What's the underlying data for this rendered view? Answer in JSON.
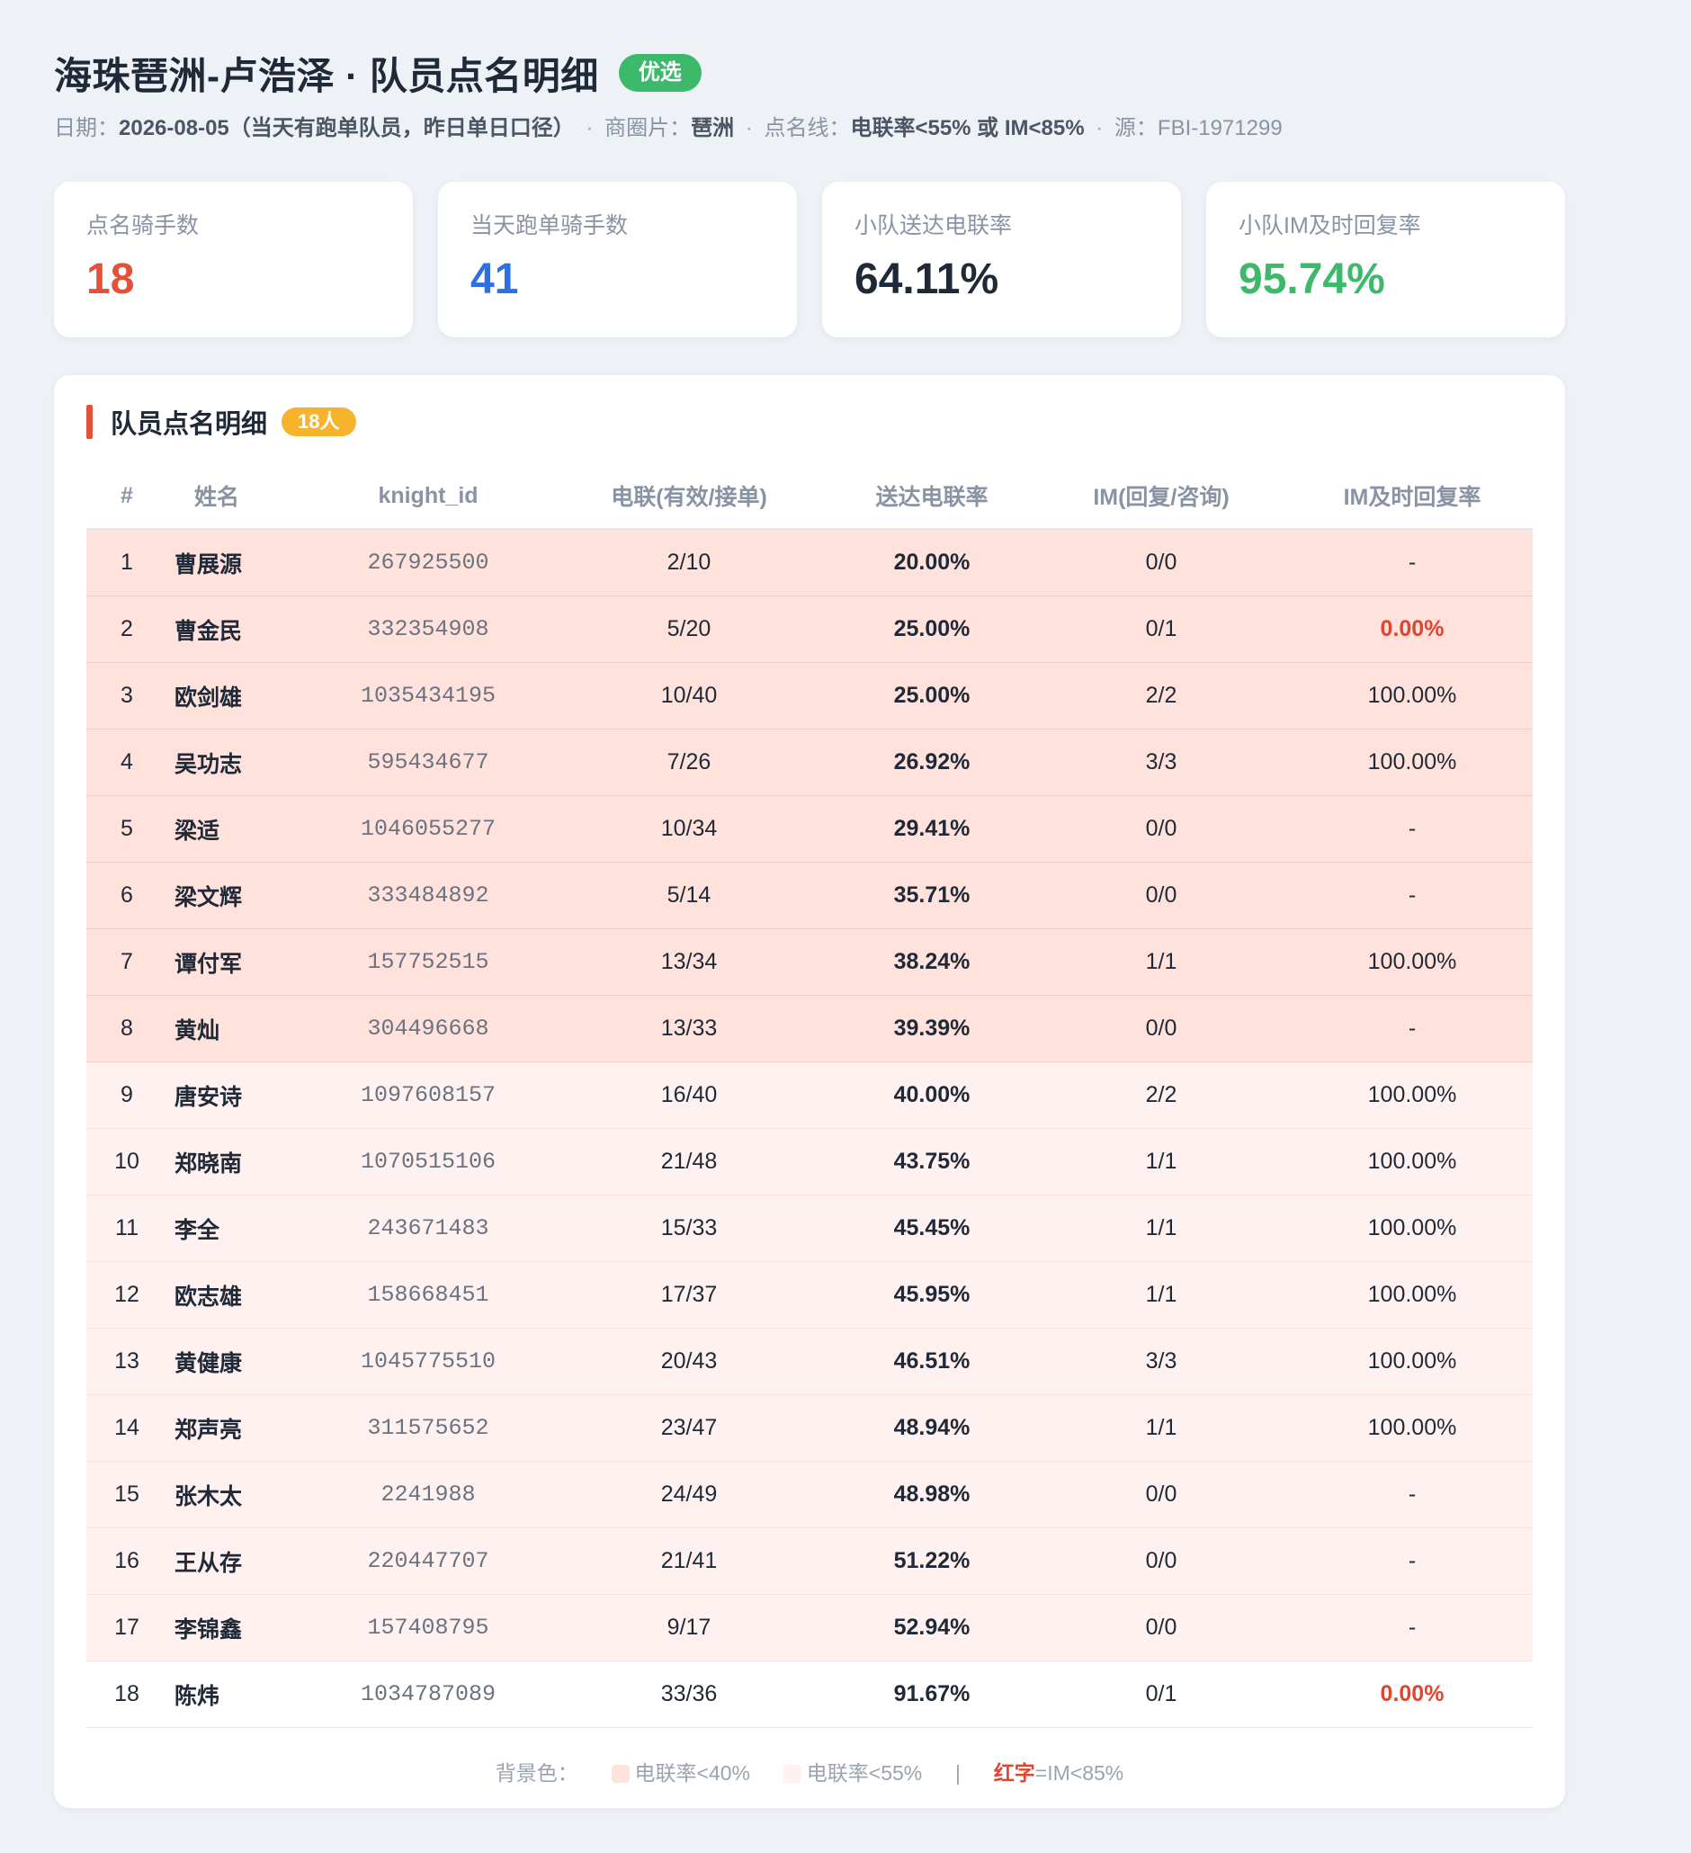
{
  "header": {
    "title": "海珠琶洲-卢浩泽 · 队员点名明细",
    "badge": "优选",
    "date_label": "日期：",
    "date_value": "2026-08-05（当天有跑单队员，昨日单日口径）",
    "sep1": "·",
    "area_label": "商圈片：",
    "area_value": "琶洲",
    "sep2": "·",
    "line_label": "点名线：",
    "line_value": "电联率<55% 或 IM<85%",
    "sep3": "·",
    "source_text": "源：FBI-1971299"
  },
  "stats": [
    {
      "label": "点名骑手数",
      "value": "18",
      "color": "#e4513b"
    },
    {
      "label": "当天跑单骑手数",
      "value": "41",
      "color": "#2f6fe4"
    },
    {
      "label": "小队送达电联率",
      "value": "64.11%",
      "color": "#1f2937"
    },
    {
      "label": "小队IM及时回复率",
      "value": "95.74%",
      "color": "#3cb96b"
    }
  ],
  "panel": {
    "title": "队员点名明细",
    "count_badge": "18人"
  },
  "table": {
    "columns": [
      "#",
      "姓名",
      "knight_id",
      "电联(有效/接单)",
      "送达电联率",
      "IM(回复/咨询)",
      "IM及时回复率"
    ],
    "rows": [
      {
        "no": "1",
        "name": "曹展源",
        "id": "267925500",
        "calls": "2/10",
        "rate": "20.00%",
        "im": "0/0",
        "im_rate": "-",
        "level": 1,
        "im_low": false
      },
      {
        "no": "2",
        "name": "曹金民",
        "id": "332354908",
        "calls": "5/20",
        "rate": "25.00%",
        "im": "0/1",
        "im_rate": "0.00%",
        "level": 1,
        "im_low": true
      },
      {
        "no": "3",
        "name": "欧剑雄",
        "id": "1035434195",
        "calls": "10/40",
        "rate": "25.00%",
        "im": "2/2",
        "im_rate": "100.00%",
        "level": 1,
        "im_low": false
      },
      {
        "no": "4",
        "name": "吴功志",
        "id": "595434677",
        "calls": "7/26",
        "rate": "26.92%",
        "im": "3/3",
        "im_rate": "100.00%",
        "level": 1,
        "im_low": false
      },
      {
        "no": "5",
        "name": "梁适",
        "id": "1046055277",
        "calls": "10/34",
        "rate": "29.41%",
        "im": "0/0",
        "im_rate": "-",
        "level": 1,
        "im_low": false
      },
      {
        "no": "6",
        "name": "梁文辉",
        "id": "333484892",
        "calls": "5/14",
        "rate": "35.71%",
        "im": "0/0",
        "im_rate": "-",
        "level": 1,
        "im_low": false
      },
      {
        "no": "7",
        "name": "谭付军",
        "id": "157752515",
        "calls": "13/34",
        "rate": "38.24%",
        "im": "1/1",
        "im_rate": "100.00%",
        "level": 1,
        "im_low": false
      },
      {
        "no": "8",
        "name": "黄灿",
        "id": "304496668",
        "calls": "13/33",
        "rate": "39.39%",
        "im": "0/0",
        "im_rate": "-",
        "level": 1,
        "im_low": false
      },
      {
        "no": "9",
        "name": "唐安诗",
        "id": "1097608157",
        "calls": "16/40",
        "rate": "40.00%",
        "im": "2/2",
        "im_rate": "100.00%",
        "level": 2,
        "im_low": false
      },
      {
        "no": "10",
        "name": "郑晓南",
        "id": "1070515106",
        "calls": "21/48",
        "rate": "43.75%",
        "im": "1/1",
        "im_rate": "100.00%",
        "level": 2,
        "im_low": false
      },
      {
        "no": "11",
        "name": "李全",
        "id": "243671483",
        "calls": "15/33",
        "rate": "45.45%",
        "im": "1/1",
        "im_rate": "100.00%",
        "level": 2,
        "im_low": false
      },
      {
        "no": "12",
        "name": "欧志雄",
        "id": "158668451",
        "calls": "17/37",
        "rate": "45.95%",
        "im": "1/1",
        "im_rate": "100.00%",
        "level": 2,
        "im_low": false
      },
      {
        "no": "13",
        "name": "黄健康",
        "id": "1045775510",
        "calls": "20/43",
        "rate": "46.51%",
        "im": "3/3",
        "im_rate": "100.00%",
        "level": 2,
        "im_low": false
      },
      {
        "no": "14",
        "name": "郑声亮",
        "id": "311575652",
        "calls": "23/47",
        "rate": "48.94%",
        "im": "1/1",
        "im_rate": "100.00%",
        "level": 2,
        "im_low": false
      },
      {
        "no": "15",
        "name": "张木太",
        "id": "2241988",
        "calls": "24/49",
        "rate": "48.98%",
        "im": "0/0",
        "im_rate": "-",
        "level": 2,
        "im_low": false
      },
      {
        "no": "16",
        "name": "王从存",
        "id": "220447707",
        "calls": "21/41",
        "rate": "51.22%",
        "im": "0/0",
        "im_rate": "-",
        "level": 2,
        "im_low": false
      },
      {
        "no": "17",
        "name": "李锦鑫",
        "id": "157408795",
        "calls": "9/17",
        "rate": "52.94%",
        "im": "0/0",
        "im_rate": "-",
        "level": 2,
        "im_low": false
      },
      {
        "no": "18",
        "name": "陈炜",
        "id": "1034787089",
        "calls": "33/36",
        "rate": "91.67%",
        "im": "0/1",
        "im_rate": "0.00%",
        "level": 0,
        "im_low": true
      }
    ]
  },
  "legend": {
    "prefix": "背景色：",
    "item1": "电联率<40%",
    "item1_color": "#ffe2dc",
    "item2": "电联率<55%",
    "item2_color": "#fff1ef",
    "divider": "|",
    "red_word": "红字",
    "red_rest": "=IM<85%"
  }
}
